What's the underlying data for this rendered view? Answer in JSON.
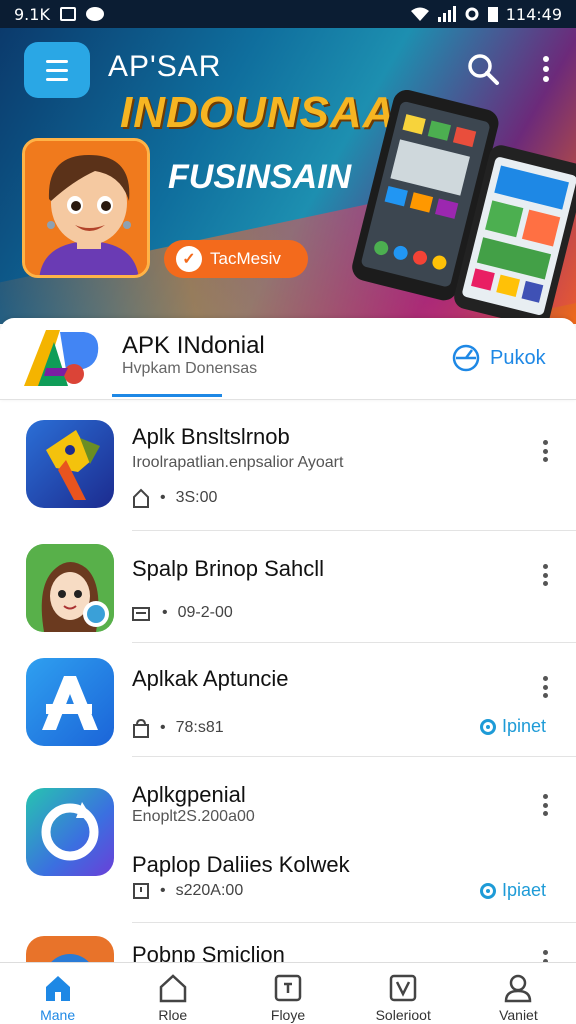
{
  "status_bar": {
    "left_text": "9.1K",
    "time": "114:49"
  },
  "banner": {
    "app_title": "AP'SAR",
    "headline": "INDOUNSAA",
    "subheadline": "FUSINSAIN",
    "cta_label": "TacMesiv",
    "colors": {
      "headline": "#f6b522",
      "cta": "#f36a1c",
      "menu_button": "#2aa7e5"
    }
  },
  "featured": {
    "title": "APK INdonial",
    "subtitle": "Hvpkam Donensas",
    "action_label": "Pukok"
  },
  "apps": [
    {
      "title": "Aplk Bnsltslrnob",
      "subtitle": "Iroolrapatlian.enpsalior Ayoart",
      "meta": "3S:00",
      "meta_icon": "house-outline-icon"
    },
    {
      "title": "Spalp Brinop Sahcll",
      "subtitle": "",
      "meta": "09-2-00",
      "meta_icon": "card-icon"
    },
    {
      "title": "Aplkak Aptuncie",
      "subtitle": "",
      "meta": "78:s81",
      "meta_icon": "bag-icon",
      "install_label": "Ipinet"
    },
    {
      "title": "Aplkgpenial",
      "subtitle": "Enoplt2S.200a00",
      "title2": "Paplop Daliies Kolwek",
      "meta": "s220A:00",
      "meta_icon": "clock-icon",
      "install_label": "Ipiaet"
    },
    {
      "title": "Pobnp Smiclion"
    }
  ],
  "bottom_nav": [
    {
      "label": "Mane",
      "icon": "home-icon",
      "active": true
    },
    {
      "label": "Rloe",
      "icon": "house-outline-icon",
      "active": false
    },
    {
      "label": "Floye",
      "icon": "square-icon",
      "active": false
    },
    {
      "label": "Solerioot",
      "icon": "checkbox-icon",
      "active": false
    },
    {
      "label": "Vaniet",
      "icon": "person-icon",
      "active": false
    }
  ],
  "accent_color": "#1e88e5"
}
